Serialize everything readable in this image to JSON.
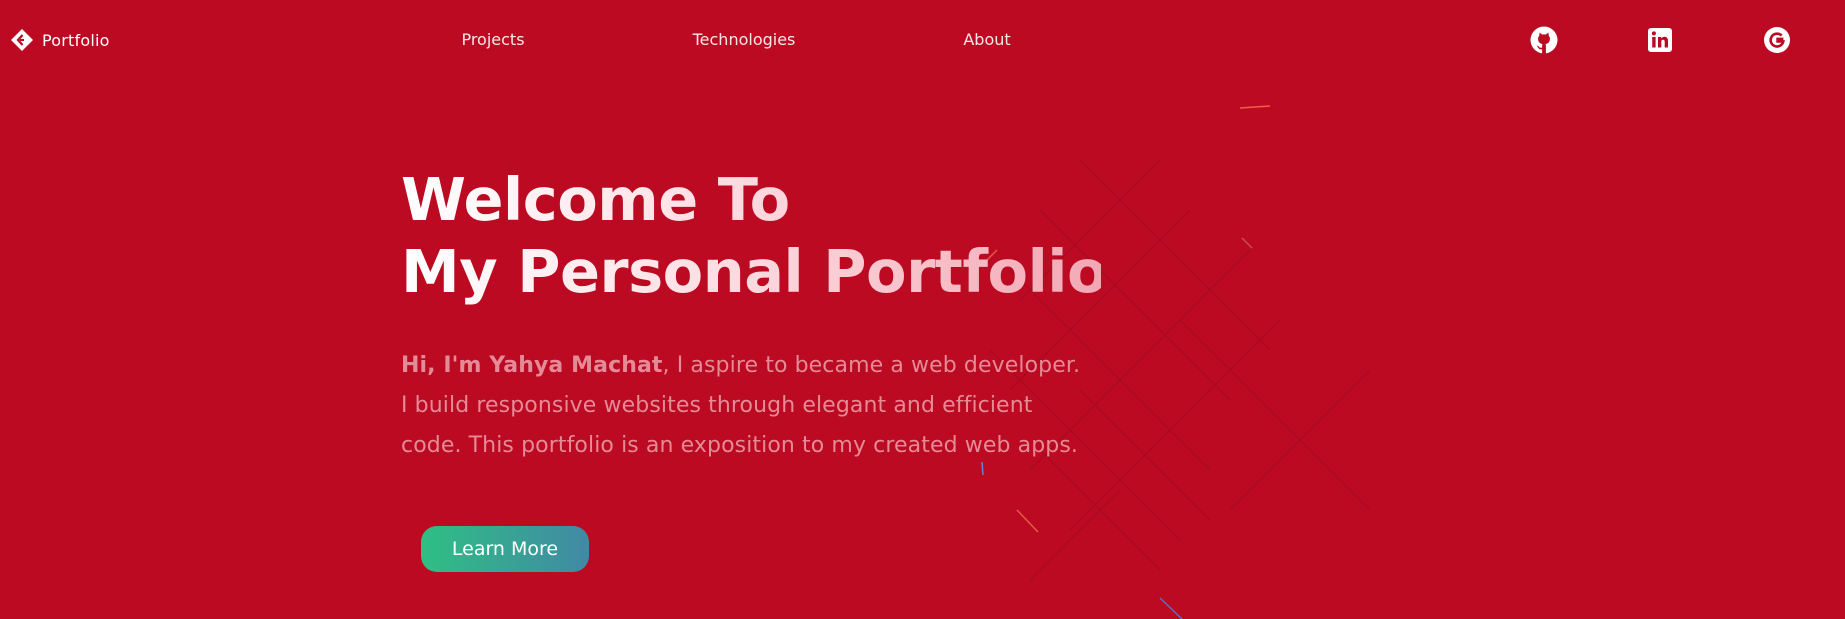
{
  "colors": {
    "background": "#bb0a21",
    "nav_text": "#f4e8e9",
    "description_text": "#e58a97",
    "button_gradient_start": "#2fbf84",
    "button_gradient_end": "#4189a4"
  },
  "nav": {
    "brand": {
      "icon": "diamond-code-icon",
      "label": "Portfolio"
    },
    "links": [
      "Projects",
      "Technologies",
      "About"
    ],
    "social": [
      {
        "icon": "github-icon"
      },
      {
        "icon": "linkedin-icon"
      },
      {
        "icon": "google-icon"
      }
    ]
  },
  "hero": {
    "title_line1": "Welcome To",
    "title_line2": "My Personal Portfolio",
    "greeting": "Hi, I'm Yahya Machat",
    "description": ", I aspire to became a web developer. I build responsive websites through elegant and efficient code. This portfolio is an exposition to my created web apps.",
    "cta_label": "Learn More"
  }
}
